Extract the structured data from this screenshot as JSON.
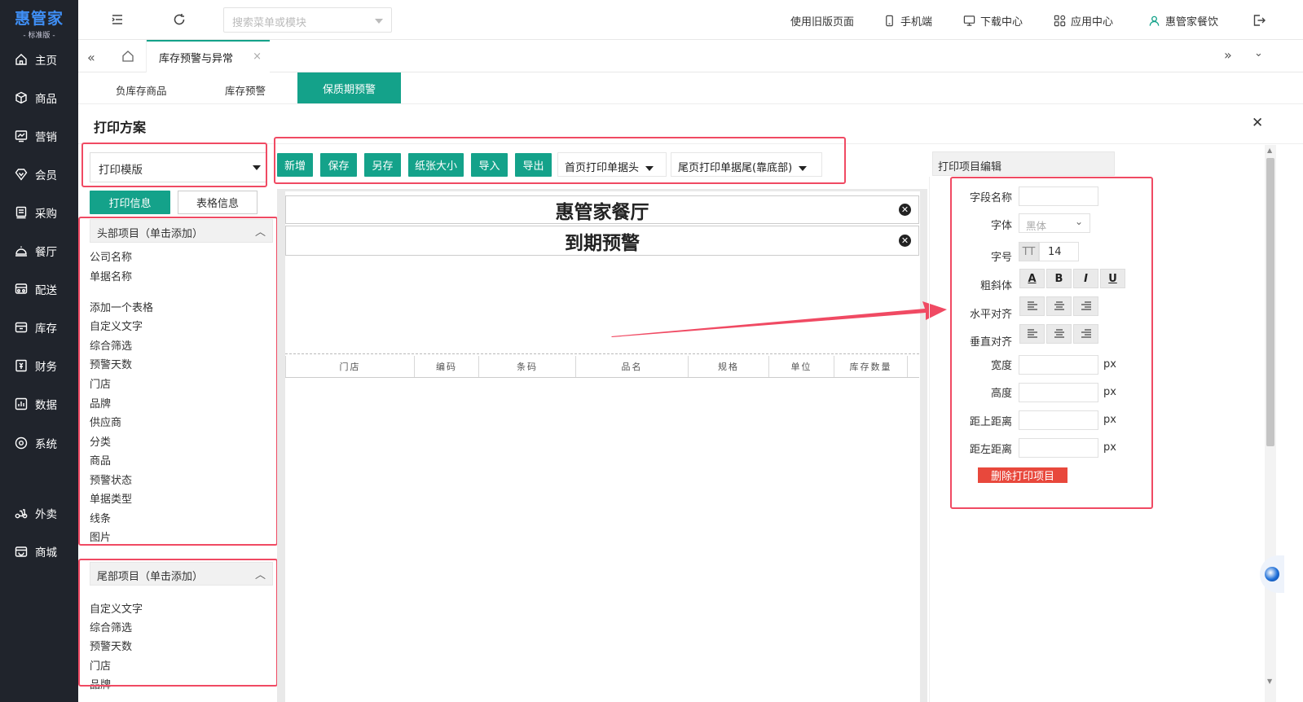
{
  "brand": {
    "title": "惠管家",
    "subtitle": "- 标准版 -"
  },
  "nav": [
    {
      "label": "主页",
      "icon": "home-icon"
    },
    {
      "label": "商品",
      "icon": "box-icon"
    },
    {
      "label": "营销",
      "icon": "chart-icon"
    },
    {
      "label": "会员",
      "icon": "diamond-icon"
    },
    {
      "label": "采购",
      "icon": "purchase-icon"
    },
    {
      "label": "餐厅",
      "icon": "restaurant-icon"
    },
    {
      "label": "配送",
      "icon": "delivery-icon"
    },
    {
      "label": "库存",
      "icon": "inventory-icon"
    },
    {
      "label": "财务",
      "icon": "finance-icon"
    },
    {
      "label": "数据",
      "icon": "data-icon"
    },
    {
      "label": "系统",
      "icon": "settings-icon"
    },
    {
      "label": "外卖",
      "icon": "takeout-icon"
    },
    {
      "label": "商城",
      "icon": "mall-icon"
    }
  ],
  "topbar": {
    "search_placeholder": "搜索菜单或模块",
    "old_page": "使用旧版页面",
    "mobile": "手机端",
    "download": "下载中心",
    "apps": "应用中心",
    "user": "惠管家餐饮"
  },
  "tab": {
    "label": "库存预警与异常",
    "close": "×"
  },
  "subtabs": [
    "负库存商品",
    "库存预警",
    "保质期预警"
  ],
  "dialog": {
    "title": "打印方案",
    "close": "✕"
  },
  "template_select": "打印模版",
  "left_tabs": {
    "print_info": "打印信息",
    "table_info": "表格信息"
  },
  "toolbar": {
    "add": "新增",
    "save": "保存",
    "save_as": "另存",
    "paper_size": "纸张大小",
    "import": "导入",
    "export": "导出",
    "first_page_header": "首页打印单据头",
    "last_page_footer": "尾页打印单据尾(靠底部)"
  },
  "header_items": {
    "title": "头部项目（单击添加）",
    "items": [
      "公司名称",
      "单据名称",
      "",
      "添加一个表格",
      "自定义文字",
      "综合筛选",
      "预警天数",
      "门店",
      "品牌",
      "供应商",
      "分类",
      "商品",
      "预警状态",
      "单据类型",
      "线条",
      "图片"
    ]
  },
  "footer_items": {
    "title": "尾部项目（单击添加）",
    "items": [
      "自定义文字",
      "综合筛选",
      "预警天数",
      "门店",
      "品牌"
    ]
  },
  "canvas": {
    "company": "惠管家餐厅",
    "doc_name": "到期预警",
    "columns": [
      "门店",
      "编码",
      "条码",
      "品名",
      "规格",
      "单位",
      "库存数量"
    ]
  },
  "editor": {
    "title": "打印项目编辑",
    "field_name": "字段名称",
    "font_label": "字体",
    "font_value": "黑体",
    "size_label": "字号",
    "size_icon": "TT",
    "size_value": "14",
    "style_label": "粗斜体",
    "styles": [
      "A",
      "B",
      "I",
      "U"
    ],
    "halign_label": "水平对齐",
    "valign_label": "垂直对齐",
    "width_label": "宽度",
    "height_label": "高度",
    "top_label": "距上距离",
    "left_label": "距左距离",
    "unit": "px",
    "delete_btn": "删除打印项目"
  },
  "colors": {
    "sidebar": "#20242c",
    "accent": "#14a28a",
    "highlight": "#f04a63",
    "danger": "#e8483c",
    "brand_blue": "#3f8ff6"
  }
}
